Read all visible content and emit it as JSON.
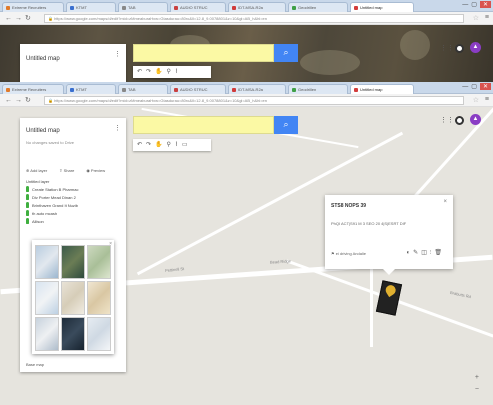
{
  "tabs": [
    {
      "label": "Extreme Recruiters",
      "color": "#e07a2b"
    },
    {
      "label": "KTMT",
      "color": "#3a6fcf"
    },
    {
      "label": "TAB",
      "color": "#888888"
    },
    {
      "label": "AUDIO STRUC",
      "color": "#c94040"
    },
    {
      "label": "IDT-MSA-R2a",
      "color": "#d03a3a"
    },
    {
      "label": "Geodrillen",
      "color": "#3fa046"
    },
    {
      "label": "Untitled map",
      "color": "#d33c3c"
    }
  ],
  "window_controls": {
    "min": "—",
    "max": "▢",
    "close": "✕"
  },
  "address_bar": {
    "url": "https://www.google.com/maps/d/edit?mid=zMmeaburaHxw=Gtasdurau=80ro&ll=12.8_9.0078801&z=10&gl=AB_h&hl=en"
  },
  "map": {
    "title": "Untitled map",
    "subtitle": "No changes saved to Drive",
    "search_placeholder": "",
    "search_icon": "search-icon",
    "layer_actions": [
      "Add layer",
      "Share",
      "Preview"
    ],
    "items": [
      "Untitled layer",
      "Create Station B Pharmac",
      "Div Porter Mead Dinan 2",
      "Brinthaven Grand It Nuzib",
      "th auto mcash",
      "Allison"
    ],
    "base_map_label": "Base map",
    "popup": {
      "title": "STS8 NOPS 39",
      "body": "PhQI ACT|S91 M 3 SEO 20 4|S|ESRT DIF",
      "footer": "ei driving Andalie"
    },
    "road_labels": [
      "Pettinell St",
      "Bead Ridge",
      "Brabutts Rd"
    ]
  },
  "colors": {
    "accent": "#4285f4",
    "search_bg": "#fbf9a4",
    "avatar": "#8a3dc4"
  }
}
